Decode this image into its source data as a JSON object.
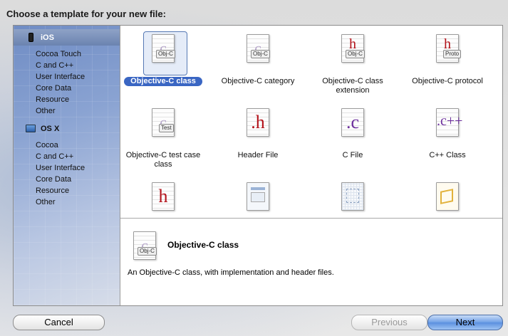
{
  "header": {
    "title": "Choose a template for your new file:"
  },
  "sidebar": {
    "ios": {
      "label": "iOS",
      "items": [
        "Cocoa Touch",
        "C and C++",
        "User Interface",
        "Core Data",
        "Resource",
        "Other"
      ]
    },
    "osx": {
      "label": "OS X",
      "items": [
        "Cocoa",
        "C and C++",
        "User Interface",
        "Core Data",
        "Resource",
        "Other"
      ]
    }
  },
  "templates": [
    {
      "label": "Objective-C class",
      "icon": "objc-class-icon",
      "tag": "Obj-C",
      "selected": true
    },
    {
      "label": "Objective-C category",
      "icon": "objc-category-icon",
      "tag": "Obj-C",
      "selected": false
    },
    {
      "label": "Objective-C class extension",
      "icon": "objc-extension-icon",
      "tag": "Obj-C",
      "glyph": "h",
      "selected": false
    },
    {
      "label": "Objective-C protocol",
      "icon": "objc-protocol-icon",
      "tag": "Proto",
      "glyph": "h",
      "selected": false
    },
    {
      "label": "Objective-C test case class",
      "icon": "objc-test-icon",
      "tag": "Test",
      "selected": false
    },
    {
      "label": "Header File",
      "icon": "header-file-icon",
      "glyph": ".h",
      "selected": false
    },
    {
      "label": "C File",
      "icon": "c-file-icon",
      "glyph": ".c",
      "selected": false
    },
    {
      "label": "C++ Class",
      "icon": "cpp-class-icon",
      "glyph": ".c++",
      "selected": false
    }
  ],
  "detail": {
    "name": "Objective-C class",
    "description": "An Objective-C class, with implementation and header files.",
    "tag": "Obj-C"
  },
  "buttons": {
    "cancel": "Cancel",
    "previous": "Previous",
    "next": "Next"
  },
  "colors": {
    "selection": "#3a66c3",
    "ios_header": "#7a90bb",
    "glyph_red": "#b3121a",
    "glyph_purple": "#6b2d9c"
  }
}
